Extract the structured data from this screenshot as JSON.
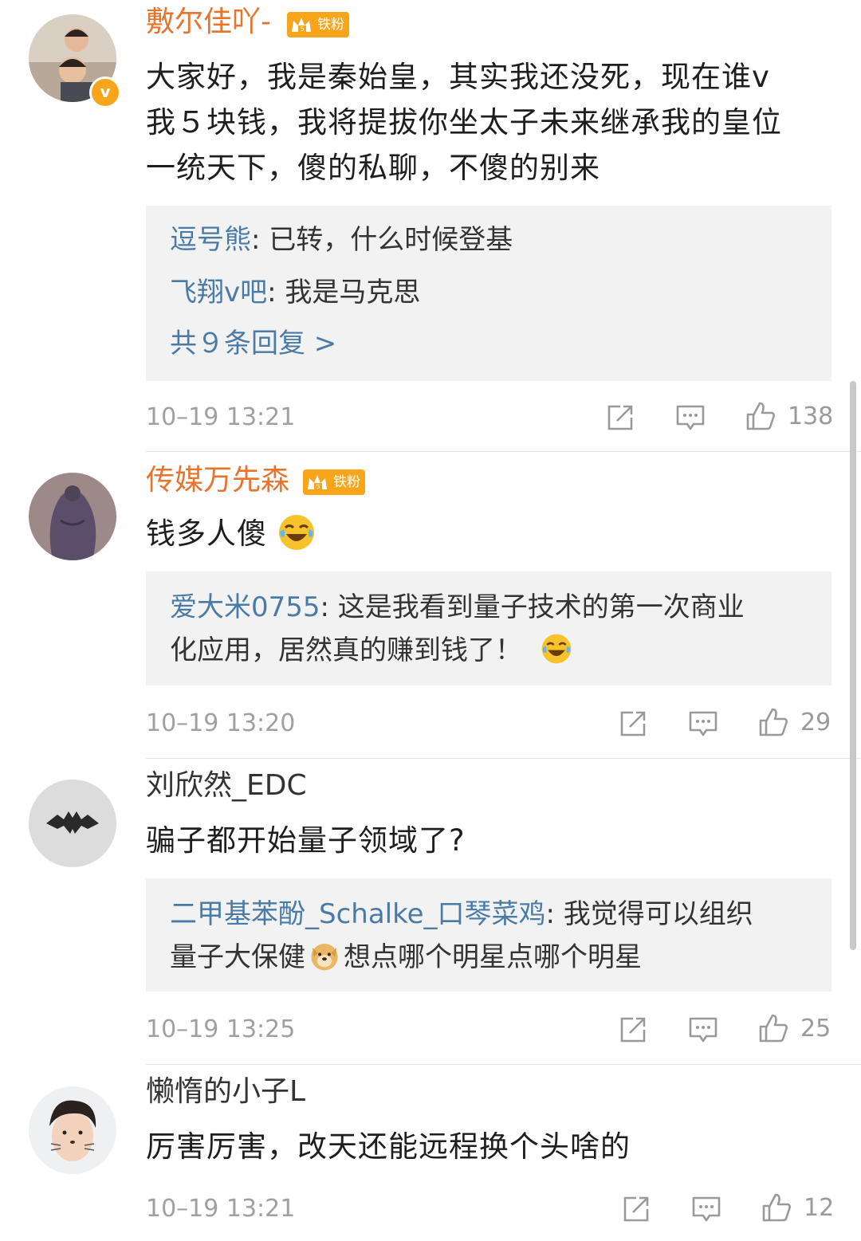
{
  "comments": [
    {
      "username": "敷尔佳吖-",
      "fan_badge": "铁粉",
      "verified_badge": "v",
      "text": [
        "大家好，我是秦始皇，其实我还没死，现在谁v",
        "我５块钱，我将提拔你坐太子未来继承我的皇位",
        "一统天下，傻的私聊，不傻的别来"
      ],
      "replies": [
        {
          "name": "逗号熊",
          "sep": ": ",
          "text": "已转，什么时候登基"
        },
        {
          "name": "飞翔v吧",
          "sep": ": ",
          "text": "我是马克思"
        }
      ],
      "more_replies": "共９条回复 >",
      "time": "10–19 13:21",
      "likes": "138"
    },
    {
      "username": "传媒万先森",
      "fan_badge": "铁粉",
      "text": [
        "钱多人傻"
      ],
      "text_emoji": "laugh-cry-emoji",
      "replies": [
        {
          "name": "爱大米0755",
          "sep": ": ",
          "text": "这是我看到量子技术的第一次商业",
          "text2": "化应用，居然真的赚到钱了！",
          "emoji": "laugh-cry-emoji"
        }
      ],
      "time": "10–19 13:20",
      "likes": "29"
    },
    {
      "username": "刘欣然_EDC",
      "text": [
        "骗子都开始量子领域了?"
      ],
      "replies": [
        {
          "name": "二甲基苯酚_Schalke_口琴菜鸡",
          "sep": ": ",
          "text": "我觉得可以组织",
          "text2": "量子大保健",
          "emoji": "doge-emoji",
          "text3": "想点哪个明星点哪个明星"
        }
      ],
      "time": "10–19 13:25",
      "likes": "25"
    },
    {
      "username": "懒惰的小子L",
      "text": [
        "厉害厉害，改天还能远程换个头啥的"
      ],
      "time": "10–19 13:21",
      "likes": "12"
    }
  ],
  "colors": {
    "vip_name": "#e8742c",
    "reply_name": "#4a7ba6",
    "badge": "#f8a51b",
    "reply_bg": "#f2f2f2",
    "meta_text": "#a0a0a0"
  },
  "icons": {
    "repost": "repost-icon",
    "comment": "comment-icon",
    "like": "thumbs-up-icon"
  }
}
